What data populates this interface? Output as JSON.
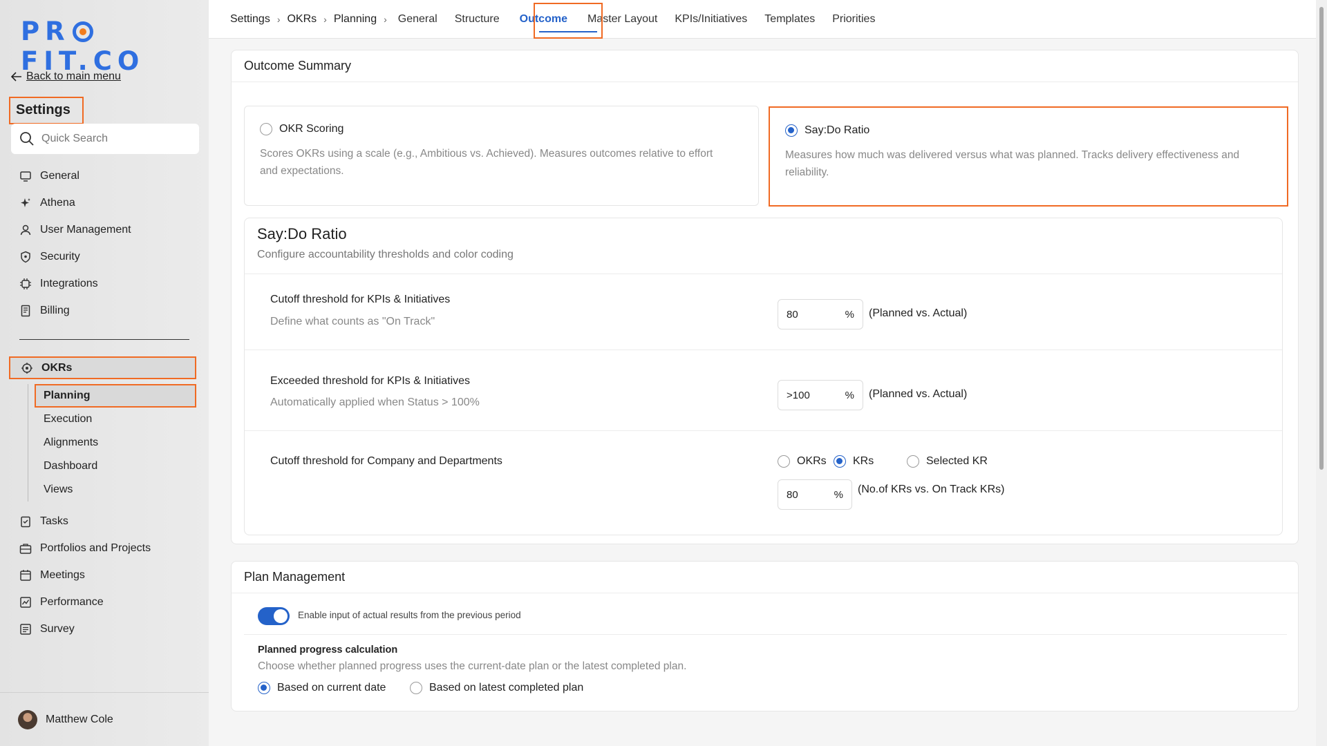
{
  "brand": {
    "logo_prefix": "PR",
    "logo_suffix": "FIT.CO"
  },
  "sidebar": {
    "back_label": "Back to main menu",
    "title": "Settings",
    "search_placeholder": "Quick Search",
    "items": [
      {
        "label": "General",
        "icon": "monitor-icon"
      },
      {
        "label": "Athena",
        "icon": "sparkle-icon"
      },
      {
        "label": "User Management",
        "icon": "user-icon"
      },
      {
        "label": "Security",
        "icon": "shield-icon"
      },
      {
        "label": "Integrations",
        "icon": "chip-icon"
      },
      {
        "label": "Billing",
        "icon": "receipt-icon"
      }
    ],
    "okrs_label": "OKRs",
    "okrs_sub": [
      "Planning",
      "Execution",
      "Alignments",
      "Dashboard",
      "Views"
    ],
    "items2": [
      {
        "label": "Tasks",
        "icon": "clipboard-icon"
      },
      {
        "label": "Portfolios and Projects",
        "icon": "briefcase-icon"
      },
      {
        "label": "Meetings",
        "icon": "calendar-icon"
      },
      {
        "label": "Performance",
        "icon": "chart-icon"
      },
      {
        "label": "Survey",
        "icon": "survey-icon"
      }
    ],
    "user_name": "Matthew Cole"
  },
  "topbar": {
    "breadcrumbs": [
      "Settings",
      "OKRs",
      "Planning"
    ],
    "separator": "›",
    "tabs": [
      "General",
      "Structure",
      "Outcome",
      "Master Layout",
      "KPIs/Initiatives",
      "Templates",
      "Priorities"
    ],
    "active_tab": "Outcome"
  },
  "outcome": {
    "title": "Outcome Summary",
    "options": [
      {
        "title": "OKR Scoring",
        "desc": "Scores OKRs using a scale (e.g., Ambitious vs. Achieved). Measures outcomes relative to effort and expectations.",
        "selected": false
      },
      {
        "title": "Say:Do Ratio",
        "desc": "Measures how much was delivered versus what was planned. Tracks delivery effectiveness and reliability.",
        "selected": true
      }
    ],
    "saydo": {
      "title": "Say:Do Ratio",
      "desc": "Configure accountability thresholds and color coding",
      "rows": [
        {
          "title": "Cutoff threshold for KPIs & Initiatives",
          "desc": "Define what counts as \"On Track\"",
          "value": "80",
          "unit": "%",
          "note": "(Planned vs. Actual)"
        },
        {
          "title": "Exceeded threshold for KPIs & Initiatives",
          "desc": "Automatically applied when Status > 100%",
          "value": ">100",
          "unit": "%",
          "note": "(Planned vs. Actual)"
        }
      ],
      "company": {
        "title": "Cutoff threshold for Company and Departments",
        "radios": [
          {
            "label": "OKRs",
            "selected": false
          },
          {
            "label": "KRs",
            "selected": true
          },
          {
            "label": "Selected KR",
            "selected": false
          }
        ],
        "value": "80",
        "unit": "%",
        "note": "(No.of KRs vs. On Track KRs)"
      }
    }
  },
  "plan": {
    "title": "Plan Management",
    "toggle_label": "Enable input of actual results from the previous period",
    "toggle_on": true,
    "calc_title": "Planned progress calculation",
    "calc_desc": "Choose whether planned progress uses the current-date plan or the latest completed plan.",
    "radios": [
      {
        "label": "Based on current date",
        "selected": true
      },
      {
        "label": "Based on latest completed plan",
        "selected": false
      }
    ]
  },
  "colors": {
    "accent": "#2462c9",
    "highlight": "#f06a23",
    "logo": "#2f6fe0"
  }
}
